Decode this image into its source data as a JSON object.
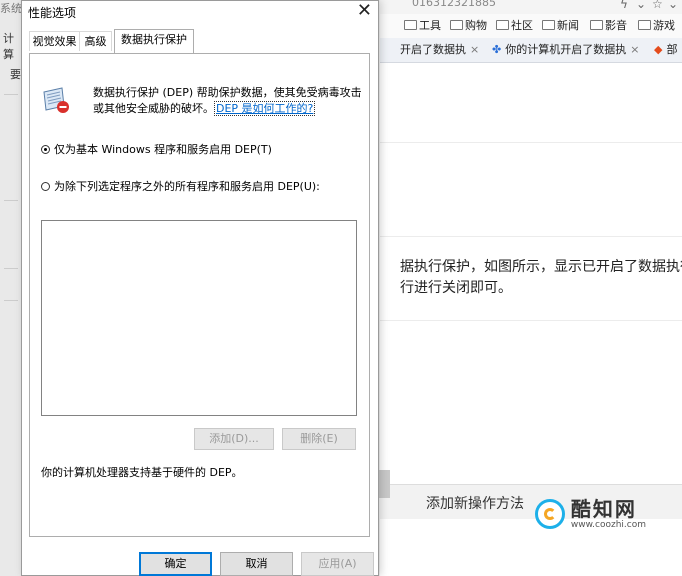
{
  "background": {
    "left_texts": [
      "系统",
      "计算",
      "要"
    ],
    "url_fragment": "016312321885",
    "bookmarks": [
      {
        "label": "工具"
      },
      {
        "label": "购物"
      },
      {
        "label": "社区"
      },
      {
        "label": "新闻"
      },
      {
        "label": "影音"
      },
      {
        "label": "游戏"
      }
    ],
    "browser_tabs": [
      {
        "label": "开启了数据执",
        "close": "×"
      },
      {
        "label": "你的计算机开启了数据执",
        "close": "×"
      },
      {
        "label": "部"
      }
    ],
    "article_lines": [
      "据执行保护，如图所示，显示已开启了数据执行",
      "行进行关闭即可。"
    ],
    "bottom_button": "添加新操作方法",
    "watermark": {
      "name": "酷知网",
      "url": "www.coozhi.com"
    }
  },
  "dialog": {
    "title": "性能选项",
    "close_glyph": "✕",
    "tabs": [
      {
        "label": "视觉效果",
        "active": false
      },
      {
        "label": "高级",
        "active": false
      },
      {
        "label": "数据执行保护",
        "active": true
      }
    ],
    "description": "数据执行保护 (DEP) 帮助保护数据，使其免受病毒攻击或其他安全威胁的破坏。",
    "link_text": "DEP 是如何工作的?",
    "radio_options": [
      {
        "label": "仅为基本 Windows 程序和服务启用 DEP(T)",
        "checked": true
      },
      {
        "label": "为除下列选定程序之外的所有程序和服务启用 DEP(U):",
        "checked": false
      }
    ],
    "list_buttons": {
      "add": "添加(D)...",
      "delete": "删除(E)"
    },
    "support_text": "你的计算机处理器支持基于硬件的 DEP。",
    "buttons": {
      "ok": "确定",
      "cancel": "取消",
      "apply": "应用(A)"
    }
  },
  "colors": {
    "accent": "#0078d7",
    "link": "#0066cc",
    "watermark_blue": "#1db0e9",
    "watermark_orange": "#f5a623"
  }
}
